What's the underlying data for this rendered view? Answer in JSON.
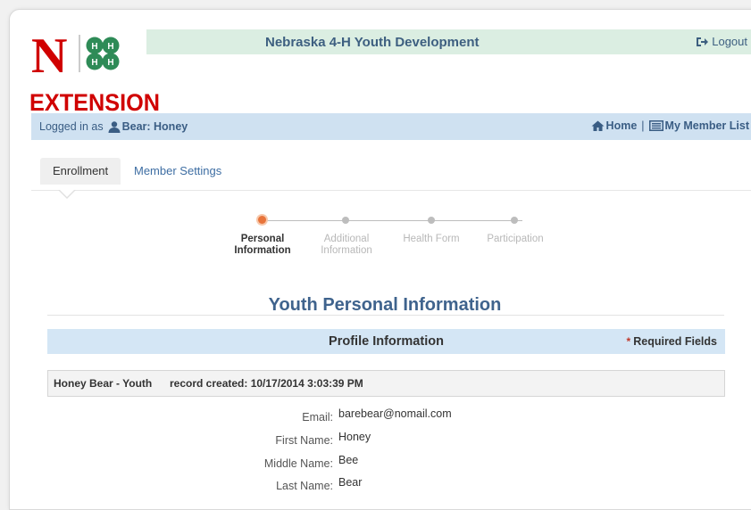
{
  "header": {
    "logo_text": "EXTENSION",
    "logo_initial": "N",
    "title": "Nebraska 4-H Youth Development",
    "logout_label": "Logout"
  },
  "userbar": {
    "logged_in_prefix": "Logged in as",
    "user_name": "Bear: Honey",
    "home_label": "Home",
    "separator": "|",
    "member_list_label": "My Member List"
  },
  "tabs": [
    {
      "label": "Enrollment",
      "active": true
    },
    {
      "label": "Member Settings",
      "active": false
    }
  ],
  "steps": [
    {
      "label_line1": "Personal",
      "label_line2": "Information",
      "active": true
    },
    {
      "label_line1": "Additional",
      "label_line2": "Information",
      "active": false
    },
    {
      "label_line1": "Health Form",
      "label_line2": "",
      "active": false
    },
    {
      "label_line1": "Participation",
      "label_line2": "",
      "active": false
    }
  ],
  "page_title": "Youth Personal Information",
  "profile": {
    "title": "Profile Information",
    "required_marker": "*",
    "required_label": "Required Fields",
    "record_name": "Honey Bear - Youth",
    "record_created": "record created: 10/17/2014 3:03:39 PM"
  },
  "fields": [
    {
      "label": "Email:",
      "value": "barebear@nomail.com"
    },
    {
      "label": "First Name:",
      "value": "Honey"
    },
    {
      "label": "Middle Name:",
      "value": "Bee"
    },
    {
      "label": "Last Name:",
      "value": "Bear"
    }
  ],
  "colors": {
    "brand_red": "#d00000",
    "clover_green": "#2e8b57",
    "link_blue": "#3e6ea3",
    "active_step": "#e8743b"
  },
  "icons": {
    "logout": "sign-out-icon",
    "user": "user-icon",
    "home": "home-icon",
    "list": "list-icon"
  }
}
